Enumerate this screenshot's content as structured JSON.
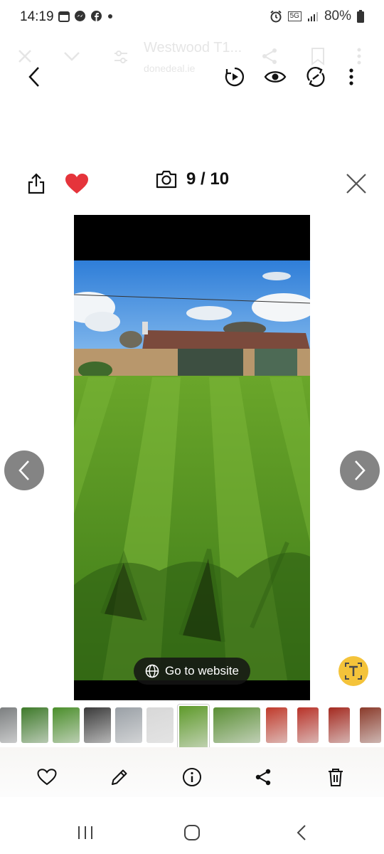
{
  "status_bar": {
    "time": "14:19",
    "network": "5G",
    "battery": "80%"
  },
  "browser": {
    "title": "Westwood T1...",
    "subtitle": "donedeal.ie"
  },
  "viewer": {
    "counter": "9 / 10",
    "go_to_website_label": "Go to website"
  },
  "colors": {
    "heart": "#e5343b",
    "sky": "#3d8ce0",
    "grass": "#4f8f1e",
    "ocr_badge": "#f4c33a"
  },
  "thumbnails": [
    {
      "name": "thumb-1",
      "tone": "#7c7f80"
    },
    {
      "name": "thumb-2",
      "tone": "#3e7a2a"
    },
    {
      "name": "thumb-3",
      "tone": "#4a8e2a"
    },
    {
      "name": "thumb-4",
      "tone": "#3a3a3a"
    },
    {
      "name": "thumb-5",
      "tone": "#9aa0a6"
    },
    {
      "name": "thumb-6",
      "tone": "#d8d8d8"
    },
    {
      "name": "thumb-7",
      "tone": "#5e9a2a"
    },
    {
      "name": "thumb-8",
      "tone": "#5a8f34"
    },
    {
      "name": "thumb-9",
      "tone": "#c03a2b"
    },
    {
      "name": "thumb-10",
      "tone": "#b83228"
    },
    {
      "name": "thumb-11",
      "tone": "#a42a20"
    },
    {
      "name": "thumb-12",
      "tone": "#8a3a2a"
    }
  ]
}
